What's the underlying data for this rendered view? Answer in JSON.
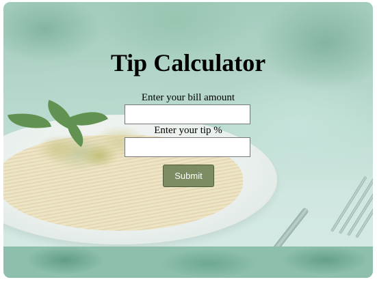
{
  "app": {
    "title": "Tip Calculator"
  },
  "form": {
    "bill_label": "Enter your bill amount",
    "bill_value": "",
    "tip_label": "Enter your tip %",
    "tip_value": "",
    "submit_label": "Submit"
  },
  "colors": {
    "submit_button": "#7d8b62",
    "background_tint": "#9ec8b8"
  }
}
